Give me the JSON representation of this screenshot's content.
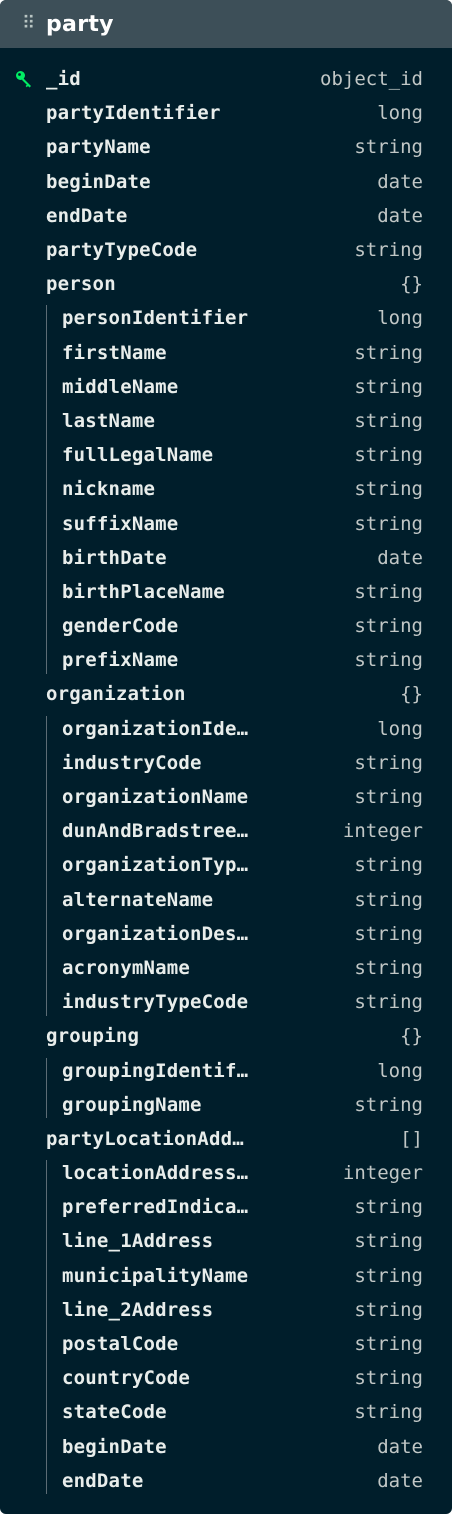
{
  "collection": {
    "name": "party",
    "drag_handle_icon": "drag-grip-icon",
    "key_icon": "key-icon",
    "key_color": "#00ed64"
  },
  "fields": [
    {
      "name": "_id",
      "type": "object_id",
      "depth": 0,
      "is_key": true
    },
    {
      "name": "partyIdentifier",
      "type": "long",
      "depth": 0
    },
    {
      "name": "partyName",
      "type": "string",
      "depth": 0
    },
    {
      "name": "beginDate",
      "type": "date",
      "depth": 0
    },
    {
      "name": "endDate",
      "type": "date",
      "depth": 0
    },
    {
      "name": "partyTypeCode",
      "type": "string",
      "depth": 0
    },
    {
      "name": "person",
      "type": "{}",
      "depth": 0
    },
    {
      "name": "personIdentifier",
      "type": "long",
      "depth": 1
    },
    {
      "name": "firstName",
      "type": "string",
      "depth": 1
    },
    {
      "name": "middleName",
      "type": "string",
      "depth": 1
    },
    {
      "name": "lastName",
      "type": "string",
      "depth": 1
    },
    {
      "name": "fullLegalName",
      "type": "string",
      "depth": 1
    },
    {
      "name": "nickname",
      "type": "string",
      "depth": 1
    },
    {
      "name": "suffixName",
      "type": "string",
      "depth": 1
    },
    {
      "name": "birthDate",
      "type": "date",
      "depth": 1
    },
    {
      "name": "birthPlaceName",
      "type": "string",
      "depth": 1
    },
    {
      "name": "genderCode",
      "type": "string",
      "depth": 1
    },
    {
      "name": "prefixName",
      "type": "string",
      "depth": 1
    },
    {
      "name": "organization",
      "type": "{}",
      "depth": 0
    },
    {
      "name": "organizationIde…",
      "type": "long",
      "depth": 1
    },
    {
      "name": "industryCode",
      "type": "string",
      "depth": 1
    },
    {
      "name": "organizationName",
      "type": "string",
      "depth": 1
    },
    {
      "name": "dunAndBradstree…",
      "type": "integer",
      "depth": 1
    },
    {
      "name": "organizationTyp…",
      "type": "string",
      "depth": 1
    },
    {
      "name": "alternateName",
      "type": "string",
      "depth": 1
    },
    {
      "name": "organizationDes…",
      "type": "string",
      "depth": 1
    },
    {
      "name": "acronymName",
      "type": "string",
      "depth": 1
    },
    {
      "name": "industryTypeCode",
      "type": "string",
      "depth": 1
    },
    {
      "name": "grouping",
      "type": "{}",
      "depth": 0
    },
    {
      "name": "groupingIdentif…",
      "type": "long",
      "depth": 1
    },
    {
      "name": "groupingName",
      "type": "string",
      "depth": 1
    },
    {
      "name": "partyLocationAdd…",
      "type": "[]",
      "depth": 0
    },
    {
      "name": "locationAddress…",
      "type": "integer",
      "depth": 1
    },
    {
      "name": "preferredIndica…",
      "type": "string",
      "depth": 1
    },
    {
      "name": "line_1Address",
      "type": "string",
      "depth": 1
    },
    {
      "name": "municipalityName",
      "type": "string",
      "depth": 1
    },
    {
      "name": "line_2Address",
      "type": "string",
      "depth": 1
    },
    {
      "name": "postalCode",
      "type": "string",
      "depth": 1
    },
    {
      "name": "countryCode",
      "type": "string",
      "depth": 1
    },
    {
      "name": "stateCode",
      "type": "string",
      "depth": 1
    },
    {
      "name": "beginDate",
      "type": "date",
      "depth": 1
    },
    {
      "name": "endDate",
      "type": "date",
      "depth": 1
    }
  ]
}
